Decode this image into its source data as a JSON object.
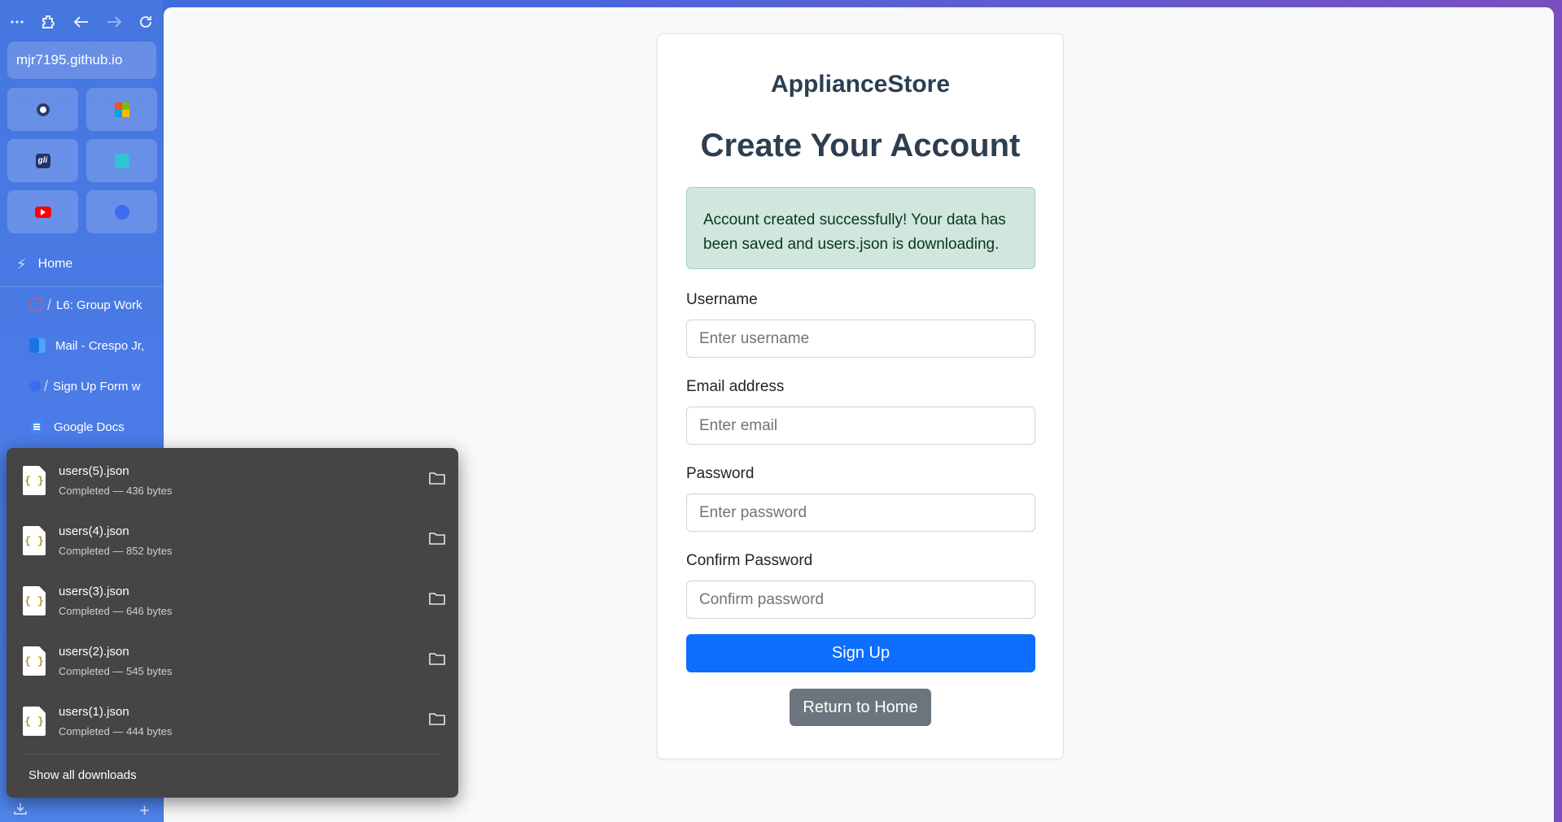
{
  "browser": {
    "url": "mjr7195.github.io",
    "home_label": "Home",
    "tabs": [
      {
        "label": "L6: Group Work"
      },
      {
        "label": "Mail - Crespo Jr,"
      },
      {
        "label": "Sign Up Form w"
      },
      {
        "label": "Google Docs"
      }
    ],
    "pinned_icons": [
      "shield-app-icon",
      "microsoft-icon",
      "glean-icon",
      "teal-app-icon",
      "youtube-icon",
      "blue-app-icon"
    ]
  },
  "page": {
    "brand": "ApplianceStore",
    "heading": "Create Your Account",
    "alert": "Account created successfully! Your data has been saved and users.json is downloading.",
    "fields": {
      "username": {
        "label": "Username",
        "placeholder": "Enter username"
      },
      "email": {
        "label": "Email address",
        "placeholder": "Enter email"
      },
      "password": {
        "label": "Password",
        "placeholder": "Enter password"
      },
      "confirm": {
        "label": "Confirm Password",
        "placeholder": "Confirm password"
      }
    },
    "signup_label": "Sign Up",
    "return_label": "Return to Home"
  },
  "downloads": {
    "items": [
      {
        "name": "users(5).json",
        "status": "Completed — 436 bytes"
      },
      {
        "name": "users(4).json",
        "status": "Completed — 852 bytes"
      },
      {
        "name": "users(3).json",
        "status": "Completed — 646 bytes"
      },
      {
        "name": "users(2).json",
        "status": "Completed — 545 bytes"
      },
      {
        "name": "users(1).json",
        "status": "Completed — 444 bytes"
      }
    ],
    "show_all": "Show all downloads"
  },
  "colors": {
    "primary": "#0d6efd",
    "secondary": "#6c757d",
    "success_bg": "#d1e7dd",
    "flyout_bg": "#454545"
  }
}
